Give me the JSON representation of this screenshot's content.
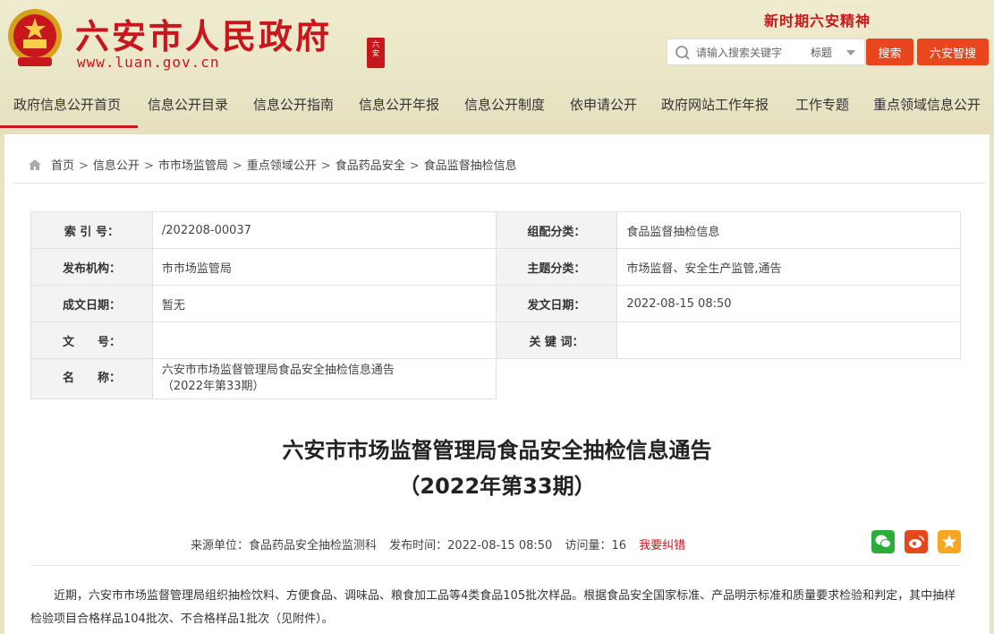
{
  "header": {
    "site_title": "六安市人民政府",
    "site_url": "www.luan.gov.cn",
    "seal_text": "六安",
    "slogan": "新时期六安精神",
    "search_placeholder": "请输入搜索关键字",
    "search_scope": "标题",
    "search_button": "搜索",
    "smart_search_button": "六安智搜"
  },
  "nav": [
    "政府信息公开首页",
    "信息公开目录",
    "信息公开指南",
    "信息公开年报",
    "信息公开制度",
    "依申请公开",
    "政府网站工作年报",
    "工作专题",
    "重点领域信息公开"
  ],
  "breadcrumb": [
    "首页",
    "信息公开",
    "市市场监管局",
    "重点领域公开",
    "食品药品安全",
    "食品监督抽检信息"
  ],
  "meta": {
    "index_label": "索 引 号：",
    "index_value": "/202208-00037",
    "category_label": "组配分类：",
    "category_value": "食品监督抽检信息",
    "publisher_label": "发布机构：",
    "publisher_value": "市市场监管局",
    "topic_label": "主题分类：",
    "topic_value": "市场监督、安全生产监管,通告",
    "created_label": "成文日期：",
    "created_value": "暂无",
    "issued_label": "发文日期：",
    "issued_value": "2022-08-15 08:50",
    "docno_label": "文　　号：",
    "docno_value": "",
    "keywords_label": "关 键 词：",
    "keywords_value": "",
    "name_label": "名　　称：",
    "name_value_line1": "六安市市场监督管理局食品安全抽检信息通告",
    "name_value_line2": "（2022年第33期）"
  },
  "article": {
    "title_line1": "六安市市场监督管理局食品安全抽检信息通告",
    "title_line2": "（2022年第33期）",
    "source": "来源单位：食品药品安全抽检监测科",
    "published": "发布时间：2022-08-15 08:50",
    "views": "访问量：16",
    "correct_link": "我要纠错",
    "body": "近期，六安市市场监督管理局组织抽检饮料、方便食品、调味品、粮食加工品等4类食品105批次样品。根据食品安全国家标准、产品明示标准和质量要求检验和判定，其中抽样检验项目合格样品104批次、不合格样品1批次（见附件）。"
  },
  "colors": {
    "brand_red": "#c8161d",
    "button_orange": "#e8461d",
    "header_bg": "#efeccf"
  },
  "icons": [
    "national-emblem-icon",
    "search-icon",
    "home-icon",
    "wechat-icon",
    "weibo-icon",
    "favorite-star-icon"
  ]
}
